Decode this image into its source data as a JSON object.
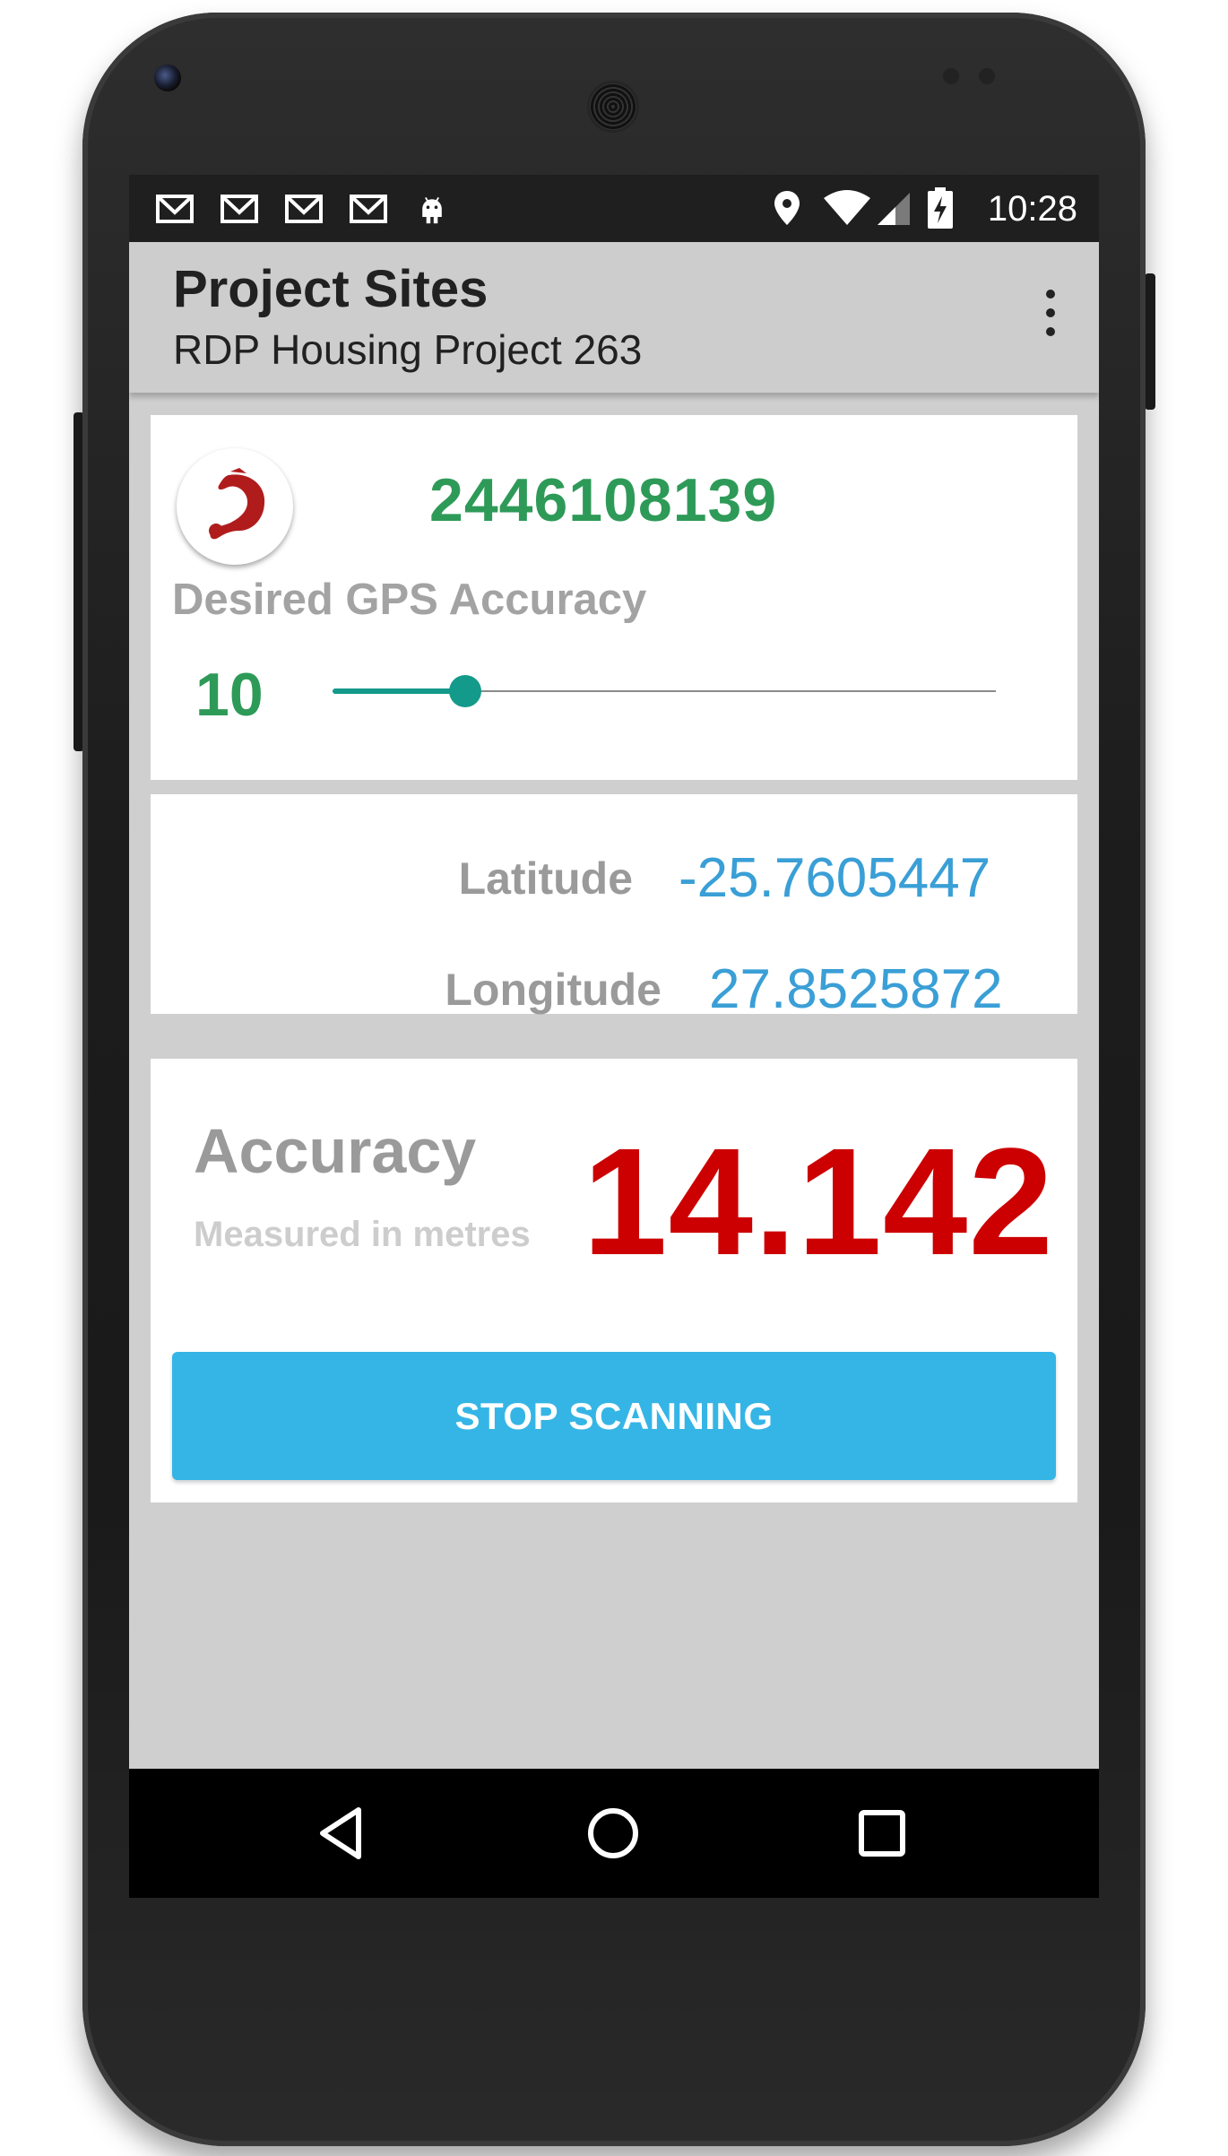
{
  "status_bar": {
    "time": "10:28",
    "notification_icons": [
      "gmail-icon",
      "gmail-icon",
      "gmail-icon",
      "gmail-icon",
      "android-icon"
    ],
    "system_icons": [
      "location-icon",
      "wifi-icon",
      "signal-icon",
      "battery-charging-icon"
    ]
  },
  "app_bar": {
    "title": "Project Sites",
    "subtitle": "RDP Housing Project 263",
    "menu_icon": "overflow-menu-icon"
  },
  "site_card": {
    "site_id": "2446108139",
    "desired_accuracy_label": "Desired GPS Accuracy",
    "desired_accuracy_value": "10",
    "slider_fraction": 0.2
  },
  "coordinates": {
    "latitude_label": "Latitude",
    "latitude_value": "-25.7605447",
    "longitude_label": "Longitude",
    "longitude_value": "27.8525872"
  },
  "accuracy_card": {
    "label": "Accuracy",
    "sublabel": "Measured in metres",
    "value": "14.142",
    "stop_button_label": "STOP SCANNING"
  },
  "colors": {
    "green": "#2e9a58",
    "blue": "#3a9fd6",
    "red": "#cc0000",
    "button": "#35b5e6",
    "teal": "#139a8a"
  },
  "nav_bar": {
    "icons": [
      "back-icon",
      "home-icon",
      "recents-icon"
    ]
  }
}
